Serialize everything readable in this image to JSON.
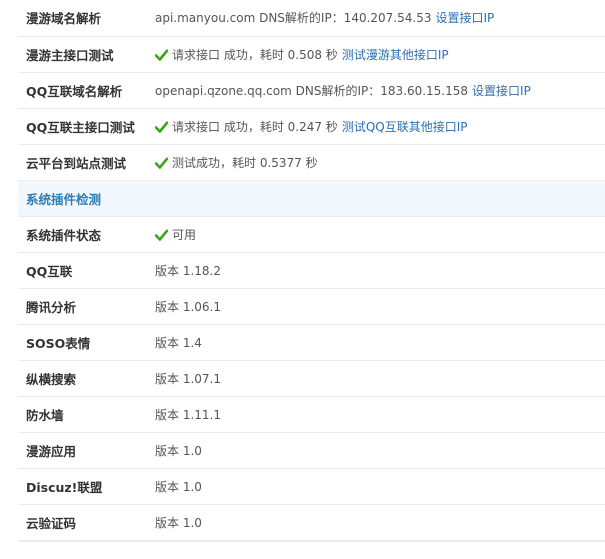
{
  "colors": {
    "link": "#2f6eb0",
    "section_header_text": "#2e7db5",
    "section_header_bg": "#f2f8fc",
    "check_icon": "#3aa41b",
    "row_border": "#e9eef2"
  },
  "rows": [
    {
      "label": "漫游域名解析",
      "text": "api.manyou.com DNS解析的IP：140.207.54.53",
      "link": "设置接口IP"
    },
    {
      "label": "漫游主接口测试",
      "icon": "check-icon",
      "text": "请求接口 成功，耗时 0.508 秒",
      "link": "测试漫游其他接口IP"
    },
    {
      "label": "QQ互联域名解析",
      "text": "openapi.qzone.qq.com DNS解析的IP：183.60.15.158",
      "link": "设置接口IP"
    },
    {
      "label": "QQ互联主接口测试",
      "icon": "check-icon",
      "text": "请求接口 成功，耗时 0.247 秒",
      "link": "测试QQ互联其他接口IP"
    },
    {
      "label": "云平台到站点测试",
      "icon": "check-icon",
      "text": "测试成功，耗时 0.5377 秒"
    }
  ],
  "section": {
    "title": "系统插件检测"
  },
  "plugin_status": {
    "label": "系统插件状态",
    "icon": "check-icon",
    "text": "可用"
  },
  "plugins": [
    {
      "label": "QQ互联",
      "version": "版本 1.18.2"
    },
    {
      "label": "腾讯分析",
      "version": "版本 1.06.1"
    },
    {
      "label": "SOSO表情",
      "version": "版本 1.4"
    },
    {
      "label": "纵横搜索",
      "version": "版本 1.07.1"
    },
    {
      "label": "防水墙",
      "version": "版本 1.11.1"
    },
    {
      "label": "漫游应用",
      "version": "版本 1.0"
    },
    {
      "label": "Discuz!联盟",
      "version": "版本 1.0"
    },
    {
      "label": "云验证码",
      "version": "版本 1.0"
    }
  ]
}
